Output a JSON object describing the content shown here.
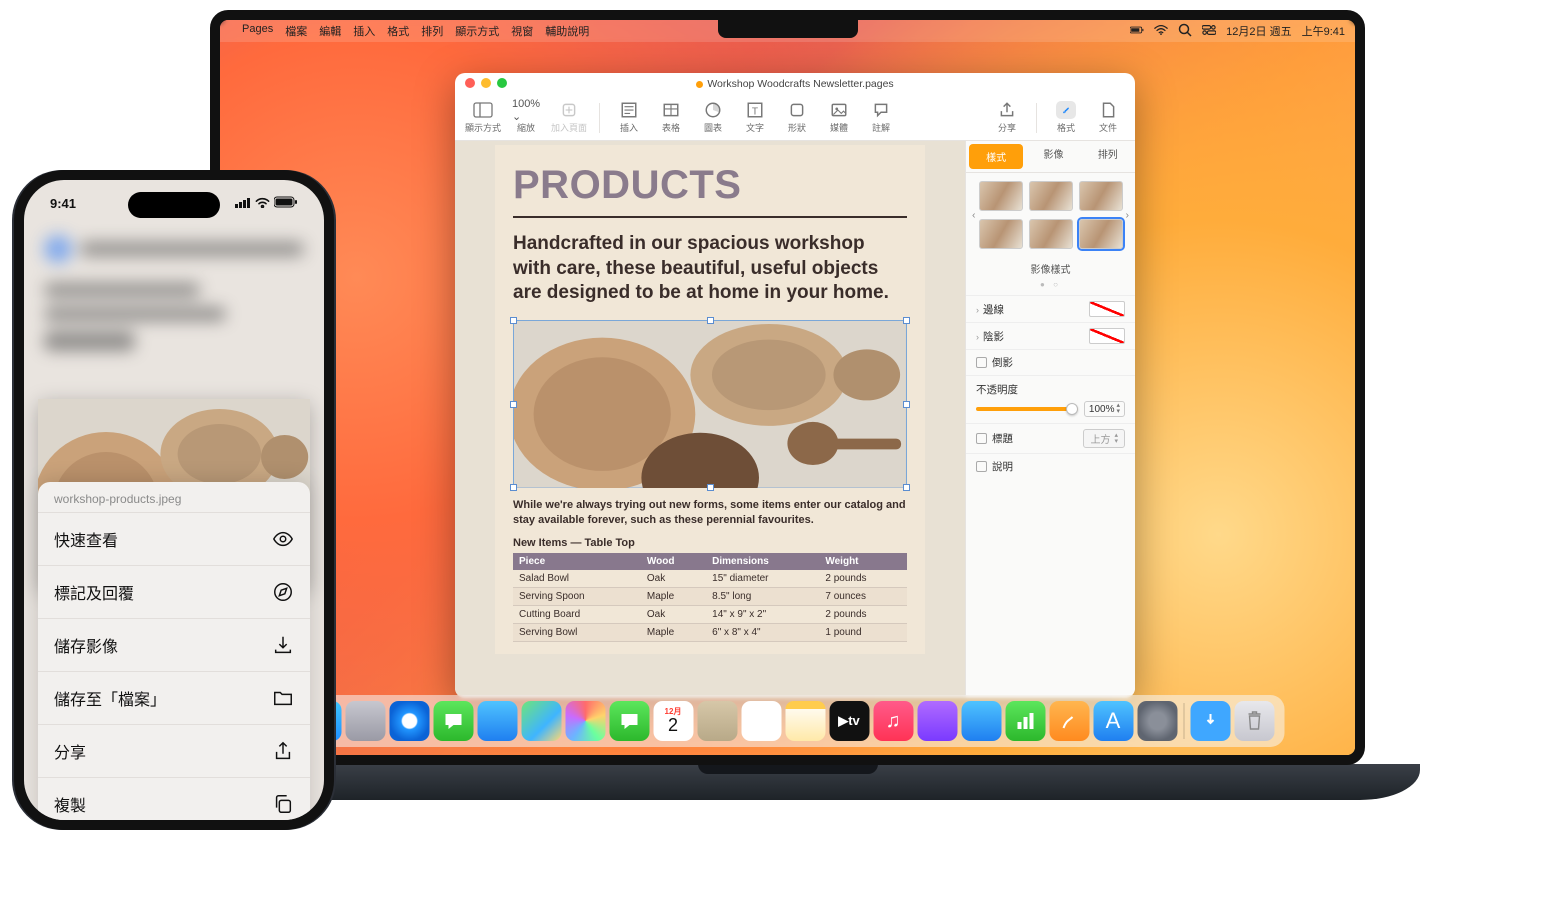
{
  "menubar": {
    "app": "Pages",
    "items": [
      "檔案",
      "編輯",
      "插入",
      "格式",
      "排列",
      "顯示方式",
      "視窗",
      "輔助說明"
    ],
    "status": {
      "date": "12月2日 週五",
      "time": "上午9:41"
    }
  },
  "window": {
    "title": "Workshop Woodcrafts Newsletter.pages",
    "toolbar": {
      "view": {
        "label": "顯示方式"
      },
      "zoom": {
        "value": "100% ⌄",
        "label": "縮放"
      },
      "addpage": {
        "label": "加入頁面"
      },
      "insert": {
        "label": "插入"
      },
      "table": {
        "label": "表格"
      },
      "chart": {
        "label": "圖表"
      },
      "text": {
        "label": "文字"
      },
      "shape": {
        "label": "形狀"
      },
      "media": {
        "label": "媒體"
      },
      "comment": {
        "label": "註解"
      },
      "share": {
        "label": "分享"
      },
      "format": {
        "label": "格式"
      },
      "document": {
        "label": "文件"
      }
    }
  },
  "doc": {
    "h1": "PRODUCTS",
    "sub": "Handcrafted in our spacious workshop with care, these beautiful, useful objects are designed to be at home in your home.",
    "body": "While we're always trying out new forms, some items enter our catalog and stay available forever, such as these perennial favourites.",
    "tableTitle": "New Items — Table Top",
    "headers": [
      "Piece",
      "Wood",
      "Dimensions",
      "Weight"
    ],
    "rows": [
      [
        "Salad Bowl",
        "Oak",
        "15\" diameter",
        "2 pounds"
      ],
      [
        "Serving Spoon",
        "Maple",
        "8.5\" long",
        "7 ounces"
      ],
      [
        "Cutting Board",
        "Oak",
        "14\" x 9\" x 2\"",
        "2 pounds"
      ],
      [
        "Serving Bowl",
        "Maple",
        "6\" x 8\" x 4\"",
        "1 pound"
      ]
    ]
  },
  "inspector": {
    "tabs": {
      "style": "樣式",
      "image": "影像",
      "arrange": "排列"
    },
    "styleLabel": "影像樣式",
    "border": "邊線",
    "shadow": "陰影",
    "reflection": "倒影",
    "opacityLabel": "不透明度",
    "opacityValue": "100%",
    "caption": "標題",
    "captionPos": "上方",
    "description": "說明"
  },
  "iphone": {
    "time": "9:41",
    "filename": "workshop-products.jpeg",
    "menu": {
      "quicklook": "快速查看",
      "markup": "標記及回覆",
      "saveimg": "儲存影像",
      "savefiles": "儲存至「檔案」",
      "share": "分享",
      "copy": "複製"
    }
  },
  "dock": {
    "items": [
      {
        "name": "finder",
        "bg": "linear-gradient(#3ec6ff,#1f8fff)"
      },
      {
        "name": "launchpad",
        "bg": "linear-gradient(#c7c7cf,#9a9aa5)"
      },
      {
        "name": "safari",
        "bg": "radial-gradient(circle,#fff 25%,#2196ff 30%,#0b63d6 70%)"
      },
      {
        "name": "messages",
        "bg": "linear-gradient(#5ce65c,#2cb82c)"
      },
      {
        "name": "mail",
        "bg": "linear-gradient(#4fc3ff,#1f7ff0)"
      },
      {
        "name": "maps",
        "bg": "linear-gradient(135deg,#6fe57a,#3fb5ff 60%,#ffd970)"
      },
      {
        "name": "photos",
        "bg": "conic-gradient(#ff6b6b,#ffd36b,#6bff9e,#6bb5ff,#c96bff,#ff6b6b)"
      },
      {
        "name": "facetime",
        "bg": "linear-gradient(#5ce65c,#2cb82c)"
      },
      {
        "name": "calendar",
        "bg": "#fff"
      },
      {
        "name": "contacts",
        "bg": "linear-gradient(#d6c7a8,#b8a988)"
      },
      {
        "name": "reminders",
        "bg": "#fff"
      },
      {
        "name": "notes",
        "bg": "linear-gradient(#fff,#ffe9a8)"
      },
      {
        "name": "tv",
        "bg": "#111"
      },
      {
        "name": "music",
        "bg": "linear-gradient(#ff5a8a,#ff3355)"
      },
      {
        "name": "podcasts",
        "bg": "linear-gradient(#b06bff,#7a3aff)"
      },
      {
        "name": "news",
        "bg": "linear-gradient(#4fc3ff,#1f7ff0)"
      },
      {
        "name": "numbers",
        "bg": "linear-gradient(#5ce65c,#2cb82c)"
      },
      {
        "name": "pages",
        "bg": "linear-gradient(#ffb64f,#ff8a1f)"
      },
      {
        "name": "appstore",
        "bg": "linear-gradient(#4fc3ff,#1f7ff0)"
      },
      {
        "name": "settings",
        "bg": "radial-gradient(circle,#8a8f99 30%,#5f6570 70%)"
      }
    ],
    "calendar": {
      "month": "12月",
      "day": "2"
    },
    "tv_label": "▶tv"
  }
}
